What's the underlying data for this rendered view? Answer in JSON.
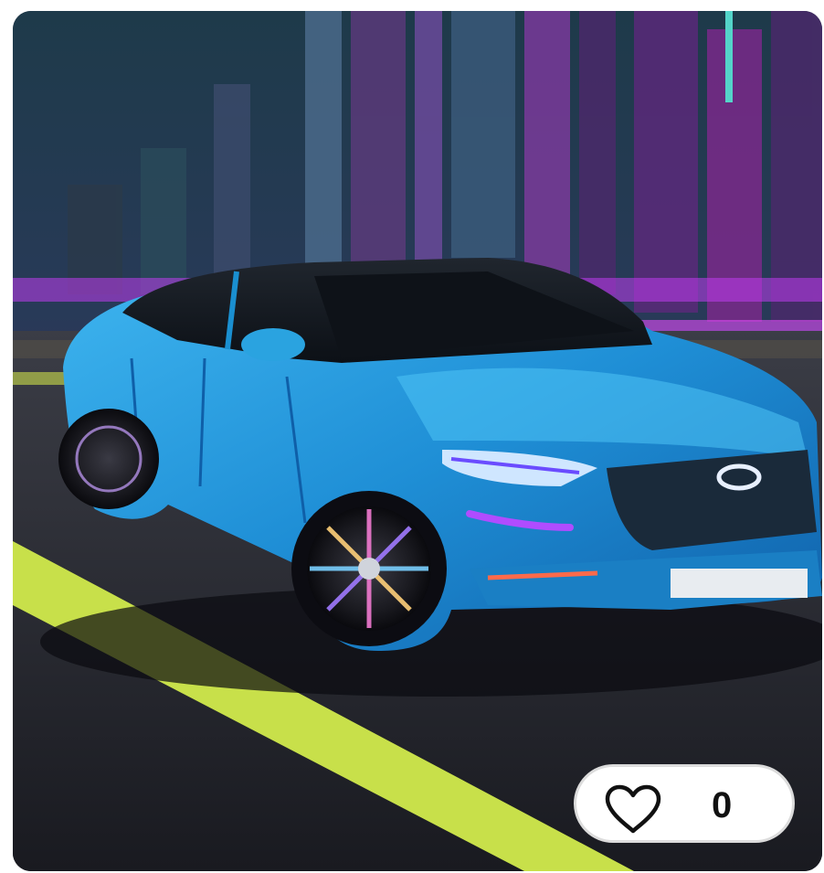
{
  "card": {
    "image_description_icon": "car-image",
    "like_button": {
      "icon": "heart-outline-icon",
      "count": "0"
    }
  },
  "colors": {
    "accent_neon": "#c03cf0",
    "lane_line": "#c8e04a",
    "car_body": "#2aa3e0"
  }
}
